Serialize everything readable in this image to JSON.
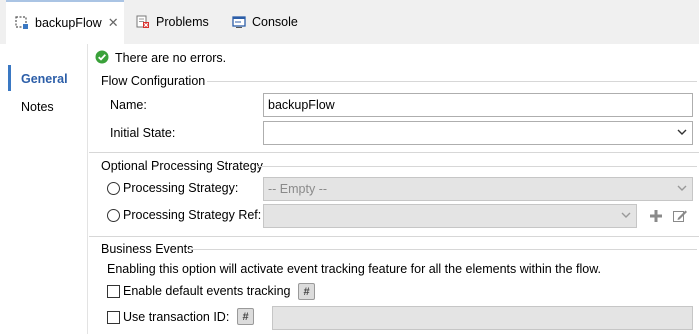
{
  "tabs": [
    {
      "label": "backupFlow",
      "active": true,
      "closable": true
    },
    {
      "label": "Problems",
      "active": false
    },
    {
      "label": "Console",
      "active": false
    }
  ],
  "nav": {
    "items": [
      {
        "label": "General",
        "selected": true
      },
      {
        "label": "Notes",
        "selected": false
      }
    ]
  },
  "status": {
    "message": "There are no errors."
  },
  "flow_config": {
    "header": "Flow Configuration",
    "name_label": "Name:",
    "name_value": "backupFlow",
    "initial_state_label": "Initial State:",
    "initial_state_value": ""
  },
  "processing": {
    "header": "Optional Processing Strategy",
    "strategy_label": "Processing Strategy:",
    "strategy_value": "-- Empty --",
    "strategy_ref_label": "Processing Strategy Ref:",
    "strategy_ref_value": ""
  },
  "business_events": {
    "header": "Business Events",
    "description": "Enabling this option will activate event tracking feature for all the elements within the flow.",
    "enable_label": "Enable default events tracking",
    "transaction_label": "Use transaction ID:",
    "transaction_value": "",
    "hash_symbol": "#"
  },
  "colors": {
    "accent": "#3a78c3",
    "tab_bar_bg": "#f0f0f0",
    "ok_green": "#3aa13a"
  }
}
